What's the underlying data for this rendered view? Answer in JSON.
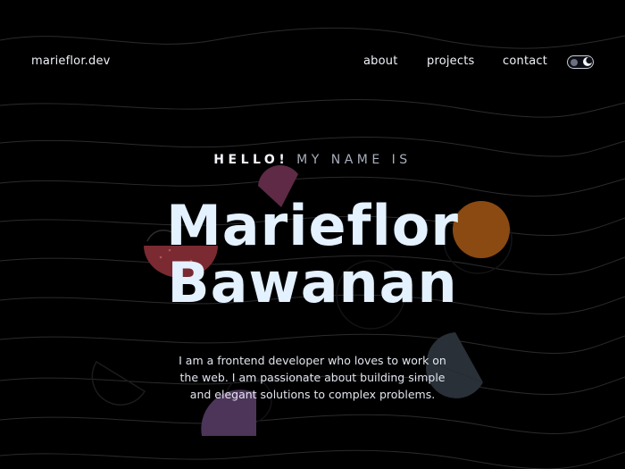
{
  "header": {
    "logo": "marieflor.dev",
    "nav": {
      "about": "about",
      "projects": "projects",
      "contact": "contact"
    },
    "theme_toggle": {
      "state": "dark",
      "icons": [
        "sun-icon",
        "moon-icon"
      ]
    }
  },
  "hero": {
    "greeting_bold": "HELLO!",
    "greeting_light": "MY NAME IS",
    "first_name": "Marieflor",
    "last_name": "Bawanan",
    "bio": "I am a frontend developer who loves to work on the web. I am passionate about building simple and elegant solutions to complex problems."
  },
  "colors": {
    "background": "#000000",
    "text": "#e9ecf4",
    "name": "#e4f1ff",
    "shape_orange": "#8a4a12",
    "shape_red": "#7a2a30",
    "shape_plum": "#5e2a45",
    "shape_purple": "#4c3559",
    "shape_slate": "#2a3038",
    "wave_lines": "#2b2b2e"
  }
}
